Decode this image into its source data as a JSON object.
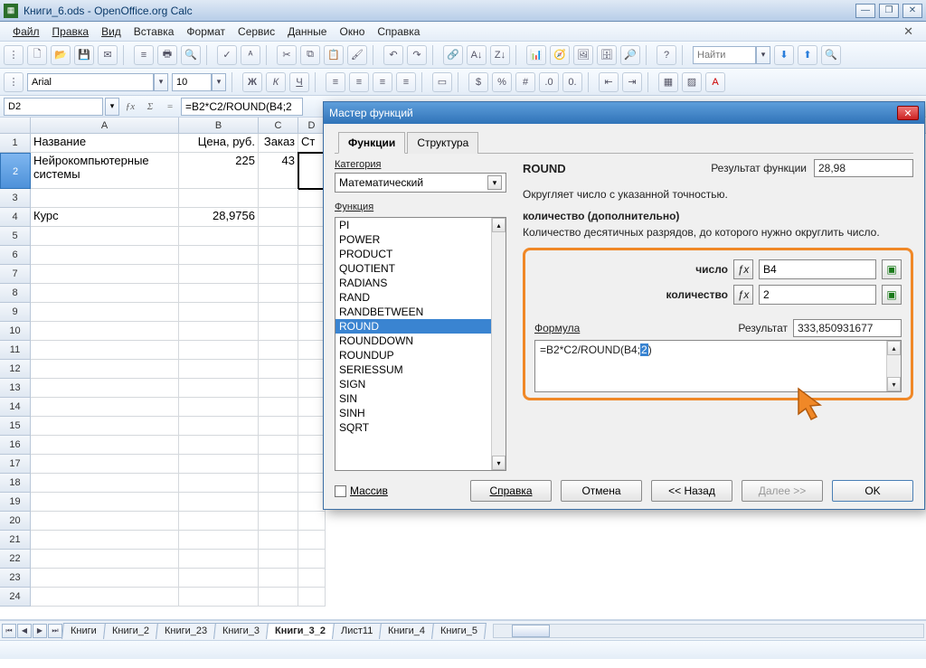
{
  "window": {
    "title": "Книги_6.ods - OpenOffice.org Calc"
  },
  "menubar": {
    "items": [
      "Файл",
      "Правка",
      "Вид",
      "Вставка",
      "Формат",
      "Сервис",
      "Данные",
      "Окно",
      "Справка"
    ]
  },
  "toolbar2": {
    "font": "Arial",
    "size": "10"
  },
  "find": {
    "placeholder": "Найти"
  },
  "formulabar": {
    "cellref": "D2",
    "formula": "=B2*C2/ROUND(B4;2"
  },
  "sheet": {
    "col_headers": [
      "A",
      "B",
      "C",
      "D"
    ],
    "rows": [
      {
        "n": "1",
        "a": "Название",
        "b": "Цена, руб.",
        "c": "Заказ",
        "d": "Ст"
      },
      {
        "n": "2",
        "a": "Нейрокомпьютерные системы",
        "b": "225",
        "c": "43",
        "d": ""
      },
      {
        "n": "3"
      },
      {
        "n": "4",
        "a": "Курс",
        "b": "28,9756"
      },
      {
        "n": "5"
      },
      {
        "n": "6"
      },
      {
        "n": "7"
      },
      {
        "n": "8"
      },
      {
        "n": "9"
      },
      {
        "n": "10"
      },
      {
        "n": "11"
      },
      {
        "n": "12"
      },
      {
        "n": "13"
      },
      {
        "n": "14"
      },
      {
        "n": "15"
      },
      {
        "n": "16"
      },
      {
        "n": "17"
      },
      {
        "n": "18"
      },
      {
        "n": "19"
      },
      {
        "n": "20"
      },
      {
        "n": "21"
      },
      {
        "n": "22"
      },
      {
        "n": "23"
      },
      {
        "n": "24"
      }
    ]
  },
  "sheet_tabs": {
    "tabs": [
      "Книги",
      "Книги_2",
      "Книги_23",
      "Книги_3",
      "Книги_3_2",
      "Лист11",
      "Книги_4",
      "Книги_5"
    ],
    "active": 4
  },
  "dialog": {
    "title": "Мастер функций",
    "tabs": {
      "t0": "Функции",
      "t1": "Структура"
    },
    "category_label": "Категория",
    "category_value": "Математический",
    "function_label": "Функция",
    "functions": [
      "PI",
      "POWER",
      "PRODUCT",
      "QUOTIENT",
      "RADIANS",
      "RAND",
      "RANDBETWEEN",
      "ROUND",
      "ROUNDDOWN",
      "ROUNDUP",
      "SERIESSUM",
      "SIGN",
      "SIN",
      "SINH",
      "SQRT"
    ],
    "selected_function": "ROUND",
    "func_name": "ROUND",
    "func_result_label": "Результат функции",
    "func_result": "28,98",
    "description": "Округляет число с указанной точностью.",
    "param_section_title": "количество (дополнительно)",
    "param_section_desc": "Количество десятичных разрядов, до которого нужно округлить число.",
    "param1_label": "число",
    "param1_value": "B4",
    "param2_label": "количество",
    "param2_value": "2",
    "formula_label": "Формула",
    "formula_text_pre": "=B2*C2/ROUND(B4;",
    "formula_text_sel": "2",
    "formula_text_post": ")",
    "result_label": "Результат",
    "result_value": "333,850931677",
    "array_label": "Массив",
    "buttons": {
      "help": "Справка",
      "cancel": "Отмена",
      "back": "<< Назад",
      "next": "Далее >>",
      "ok": "OK"
    }
  }
}
